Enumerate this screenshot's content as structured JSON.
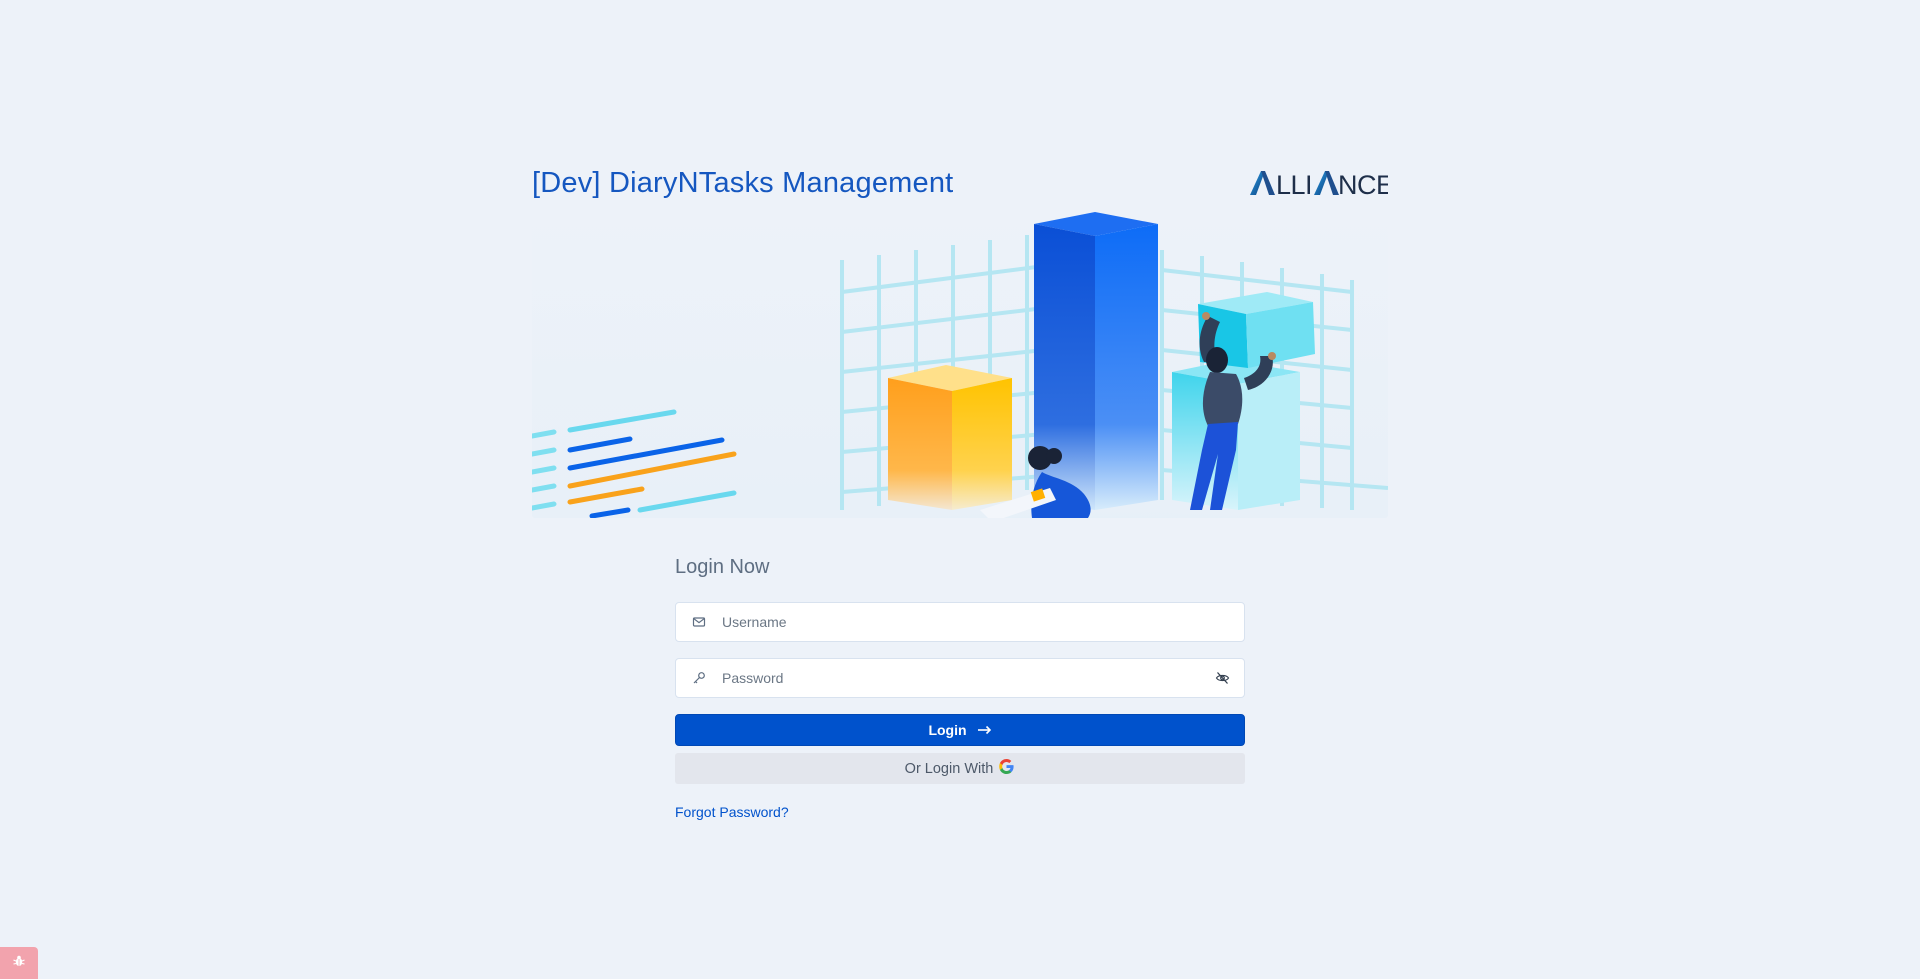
{
  "app": {
    "title": "[Dev] DiaryNTasks Management",
    "logo_text": "ALLIANCE",
    "accent_color": "#1557c0",
    "background_color": "#edf2f9"
  },
  "hero": {
    "illustration": "data-analytics-illustration"
  },
  "login": {
    "heading": "Login Now",
    "username_placeholder": "Username",
    "username_icon": "envelope-icon",
    "password_placeholder": "Password",
    "password_icon": "key-icon",
    "password_toggle_icon": "eye-slash-icon",
    "login_label": "Login",
    "login_icon": "arrow-right-icon",
    "button_color": "#0052cc",
    "google_label": "Or Login With",
    "google_icon": "google-icon",
    "forgot_label": "Forgot Password?"
  },
  "debug": {
    "icon": "bug-icon"
  }
}
